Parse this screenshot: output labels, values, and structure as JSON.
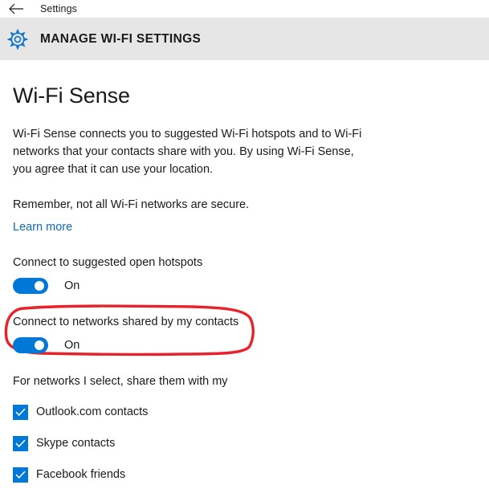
{
  "titlebar": {
    "back_icon": "back-arrow-icon",
    "title": "Settings"
  },
  "header": {
    "icon": "gear-icon",
    "title": "MANAGE WI-FI SETTINGS"
  },
  "page": {
    "title": "Wi-Fi Sense",
    "paragraph_1": "Wi-Fi Sense connects you to suggested Wi-Fi hotspots and to Wi-Fi networks that your contacts share with you. By using Wi-Fi Sense, you agree that it can use your location.",
    "paragraph_2": "Remember, not all Wi-Fi networks are secure.",
    "learn_more": "Learn more"
  },
  "settings": [
    {
      "label": "Connect to suggested open hotspots",
      "state": "On",
      "annotated": false
    },
    {
      "label": "Connect to networks shared by my contacts",
      "state": "On",
      "annotated": true
    }
  ],
  "share_section": {
    "label": "For networks I select, share them with my",
    "checkboxes": [
      {
        "label": "Outlook.com contacts",
        "checked": true
      },
      {
        "label": "Skype contacts",
        "checked": true
      },
      {
        "label": "Facebook friends",
        "checked": true
      }
    ]
  },
  "colors": {
    "accent_blue": "#0078d7",
    "link_blue": "#0b6bbf",
    "gear_blue": "#1877c9",
    "header_band": "#e6e6e6",
    "annotation_red": "#e8222a",
    "text": "#1a1a1a"
  },
  "annotation": {
    "shape": "hand-drawn-red-ellipse",
    "color": "#e8222a"
  }
}
